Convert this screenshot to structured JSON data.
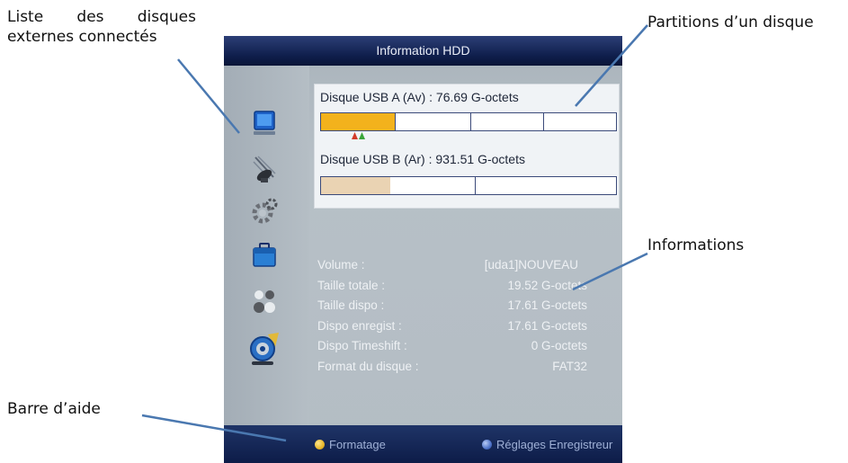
{
  "annotations": {
    "disk_list": [
      "Liste des disques",
      "externes connectés"
    ],
    "partitions": "Partitions d’un disque",
    "informations": "Informations",
    "help_bar": "Barre d’aide"
  },
  "header": {
    "title": "Information HDD"
  },
  "sidebar": {
    "icons": [
      "monitor-icon",
      "satellite-dish-icon",
      "settings-gear-icon",
      "briefcase-icon",
      "people-icon",
      "media-disc-icon"
    ]
  },
  "disks": [
    {
      "label": "Disque USB A (Av) : 76.69 G-octets",
      "partitions": 4,
      "selected_partition": 1,
      "used_fraction": 0.25,
      "selected": true
    },
    {
      "label": "Disque USB B (Ar) : 931.51 G-octets",
      "partitions": 2,
      "used_fraction": 0.23,
      "selected": false
    }
  ],
  "info": [
    {
      "key": "Volume :",
      "value": "[uda1]NOUVEAU"
    },
    {
      "key": "Taille totale :",
      "value": "19.52 G-octets"
    },
    {
      "key": "Taille dispo :",
      "value": "17.61 G-octets"
    },
    {
      "key": "Dispo enregist :",
      "value": "17.61 G-octets"
    },
    {
      "key": "Dispo Timeshift :",
      "value": "0 G-octets"
    },
    {
      "key": "Format du disque :",
      "value": "FAT32"
    }
  ],
  "help": {
    "yellow_label": "Formatage",
    "blue_label": "Réglages Enregistreur",
    "colors": {
      "yellow": "#e8b72c",
      "blue": "#4f73c9"
    }
  },
  "colors": {
    "used_selected": "#f3b21c",
    "used_other": "#ead3b3",
    "marker_red": "#d23b2b",
    "marker_green": "#3aa53a"
  }
}
